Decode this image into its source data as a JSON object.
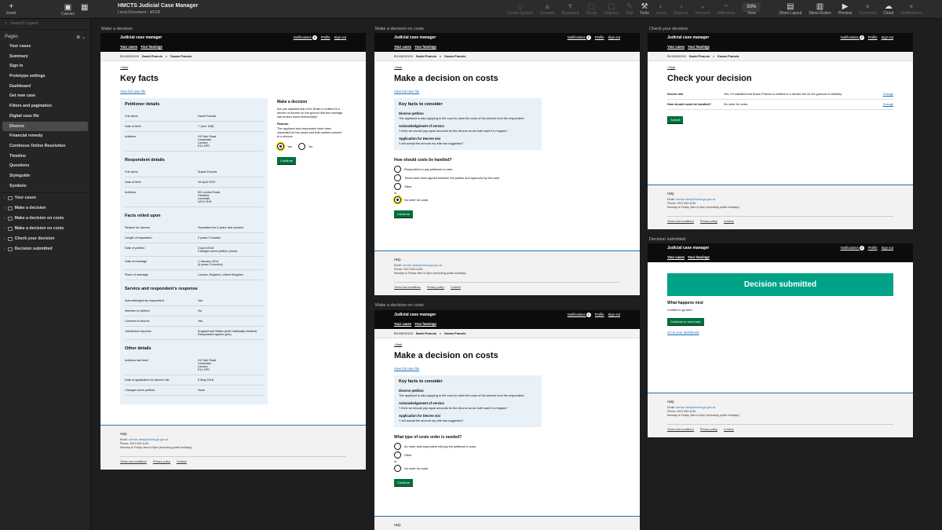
{
  "toolbar": {
    "insert": "Insert",
    "canvas": "Canvas",
    "doc_title": "HMCTS Judicial Case Manager",
    "doc_sub": "Local Document · sRGB",
    "tools": [
      "Create Symbol",
      "Forward",
      "Backward",
      "Group",
      "Ungroup",
      "Edit",
      "Tools",
      "Union",
      "Subtract",
      "Intersect",
      "Difference"
    ],
    "zoom": "50%",
    "view": "View",
    "right": [
      "Show Layout",
      "Show Rulers",
      "Preview",
      "Comment",
      "Cloud",
      "Notifications"
    ]
  },
  "sidebar": {
    "search_placeholder": "Search Layers",
    "pages_title": "Pages",
    "pages": [
      "Your cases",
      "Summary",
      "Sign in",
      "Prototype settings",
      "Dashboard",
      "Get new case",
      "Filters and pagination",
      "Digital case file",
      "Divorce",
      "Financial remedy",
      "Continous Online Resolution",
      "Timeline",
      "Questions",
      "Styleguide",
      "Symbols"
    ],
    "selected_page": "Divorce",
    "layers": [
      "Your cases",
      "Make a decision",
      "Make a decision on costs",
      "Make a decision on costs",
      "Check your decision",
      "Decision submitted"
    ]
  },
  "common": {
    "service": "Judicial case manager",
    "nav": [
      "Your cases",
      "Your hearings"
    ],
    "notifications": "Notifications",
    "notif_count": "2",
    "profile": "Profile",
    "signout": "Sign out",
    "case_no": "BV18D00153",
    "party1": "David Francis",
    "vs": "v",
    "party2": "Susan Francis",
    "back": "Back",
    "help": "Help",
    "email_lbl": "Email:",
    "email": "service-desk@hmcts.gsi.gov.uk",
    "phone": "Phone: 0207 633 4140",
    "hours": "Monday to Friday, 8am to 8pm (excluding public holidays)",
    "terms": "Terms and conditions",
    "privacy": "Privacy policy",
    "cookies": "Cookies",
    "view_file": "View full case file",
    "continue": "Continue"
  },
  "ab1": {
    "label": "Make a decision",
    "title": "Key facts",
    "petitioner_h": "Petitioner details",
    "petitioner": [
      [
        "Full name",
        "David Francis"
      ],
      [
        "Date of birth",
        "7 June 1981"
      ],
      [
        "Address",
        "24 Park Road\nLewisham\nLondon\nE11 4PR"
      ]
    ],
    "respondent_h": "Respondent details",
    "respondent": [
      [
        "Full name",
        "Susan Francis"
      ],
      [
        "Date of birth",
        "16 April 1979"
      ],
      [
        "Address",
        "89 London Road\nHinckley\nLeicester\nLE10 3HH"
      ]
    ],
    "facts_h": "Facts relied upon",
    "facts": [
      [
        "Reason for divorce",
        "Separated for 2 years and consent"
      ],
      [
        "Length of separation",
        "2 years 3 months"
      ],
      [
        "Date of petition",
        "3 April 2018\nChanges since petition (none)"
      ],
      [
        "Date of marriage",
        "1 January 2014\n(4 years 3 months)"
      ],
      [
        "Place of marriage",
        "London, England, United Kingdom"
      ]
    ],
    "service_h": "Service and respondent’s response",
    "service": [
      [
        "Acknowledged by respondent",
        "Yes"
      ],
      [
        "Intention to defend",
        "No"
      ],
      [
        "Consent to divorce",
        "Yes"
      ],
      [
        "Jurisdiction reponse",
        "England and Wales (both habitually resident)\nRespondent agrees (yes)"
      ]
    ],
    "other_h": "Other details",
    "other": [
      [
        "Address last lived",
        "24 Park Road\nLewisham\nLondon\nE11 4PR"
      ],
      [
        "Date of application for decree nisi",
        "5 May 2018"
      ],
      [
        "Changes since petition",
        "None"
      ]
    ],
    "decision_h": "Make a decision",
    "decision_q": "Are you satisfied that John Smith is entitled to a decree of divorce on the ground that the marriage has broken down irretrievably?",
    "reason_h": "Reason",
    "reason": "The applicant and respondent have been separated for two years and both parties consent to a divorce.",
    "yes": "Yes",
    "no": "No"
  },
  "ab2": {
    "label": "Make a decision on costs",
    "title": "Make a decision on costs",
    "kf_h": "Key facts to consider",
    "kf": [
      [
        "Divorce petition",
        "The applicant is also applying to the court to claim the costs of the divorce from the respondent."
      ],
      [
        "Acknowledgement of service",
        "“I think we should pay equal amounts for the divorce as we both want it to happen.”"
      ],
      [
        "Application for Decree nisi",
        "“I will accept the amount my wife has suggested.”"
      ]
    ],
    "q": "How should costs be handled?",
    "opts": [
      "Respondent to pay petitioner’s costs",
      "Terms have been agreed between the parties and approved by the court",
      "Other"
    ],
    "or": "or",
    "none": "No order for costs"
  },
  "ab3": {
    "label": "Make a decision on costs",
    "title": "Make a decision on costs",
    "q": "What type of costs order is needed?",
    "opts": [
      "An order that respondent will pay the petitioner’s costs",
      "Other"
    ],
    "or": "or",
    "none": "No order for costs"
  },
  "ab4": {
    "label": "Check your decision",
    "title": "Check your decision",
    "rows": [
      [
        "Decree nisi",
        "Yes, I’m satisfied that Susan Francis is entitled to a decree nisi on the grounds of adultery",
        "Change"
      ],
      [
        "How should costs be handled?",
        "No order for costs",
        "Change"
      ]
    ],
    "submit": "Submit"
  },
  "ab5": {
    "label": "Decision submitted",
    "banner": "Decision submitted",
    "next_h": "What happens next",
    "next": "Content to go here...",
    "btn": "Continue to next case",
    "dash": "Go to your dashboard"
  }
}
